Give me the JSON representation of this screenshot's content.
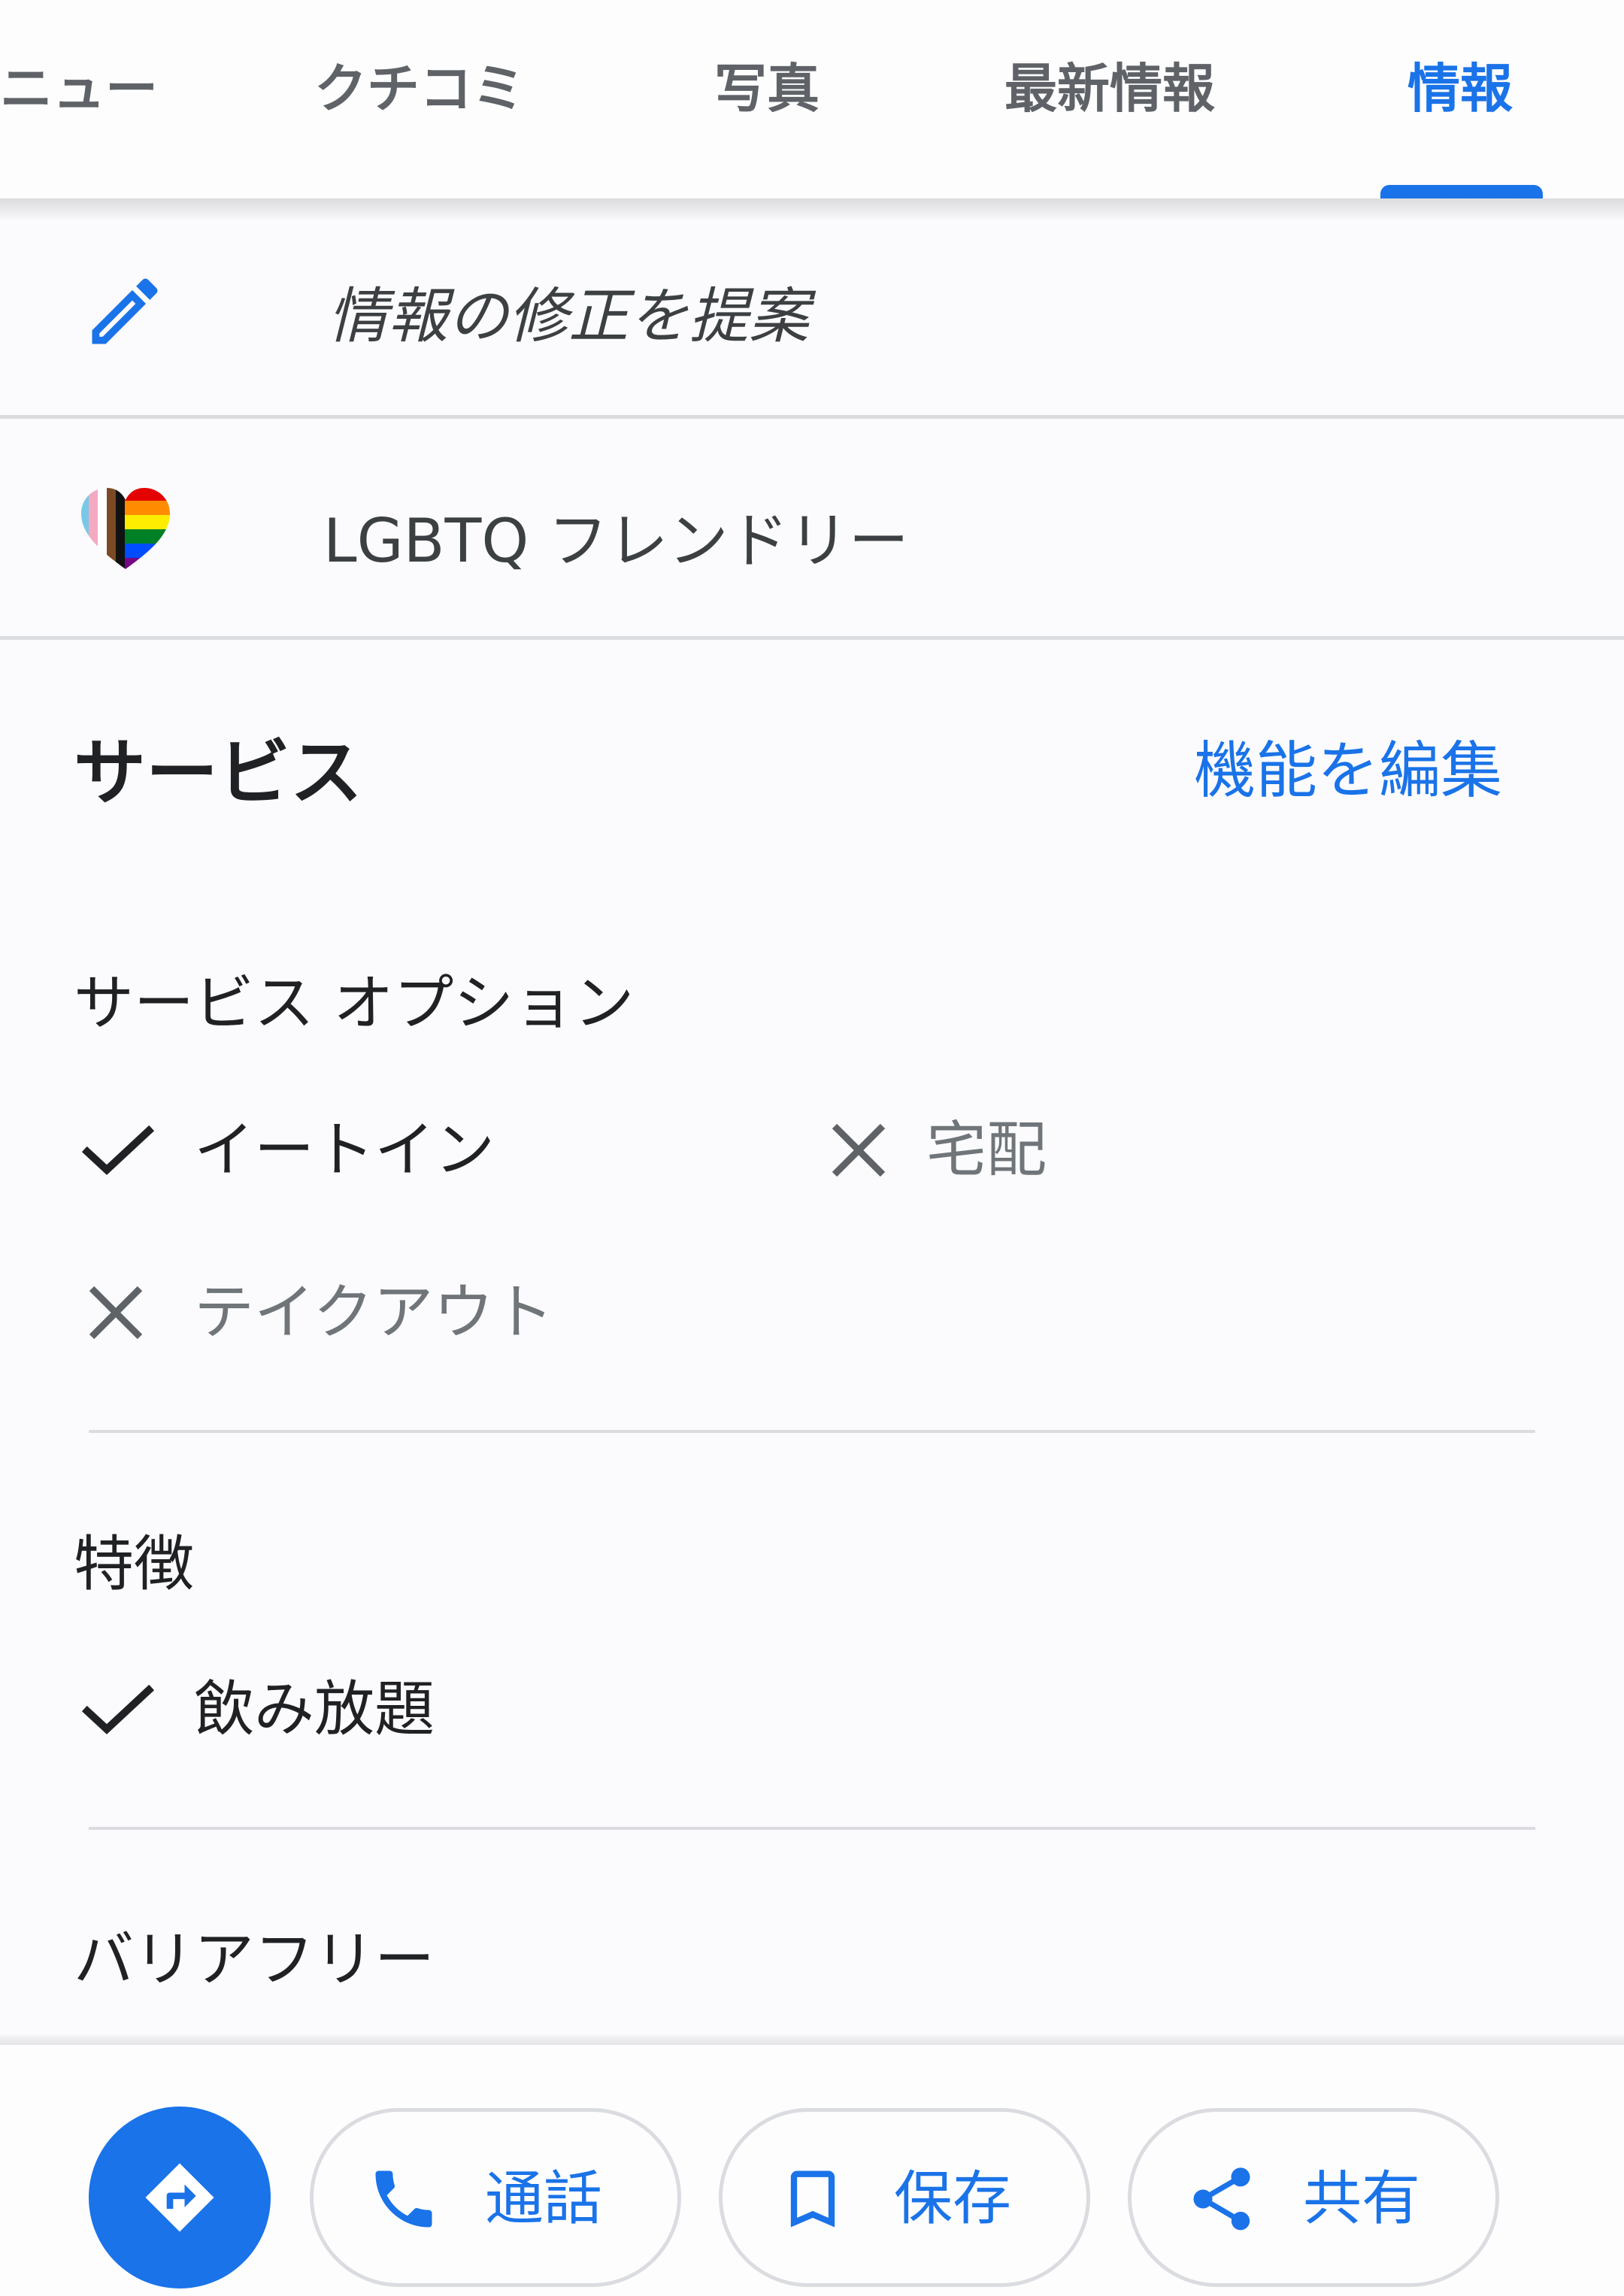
{
  "tabs": [
    {
      "label": "ニュー",
      "active": false
    },
    {
      "label": "クチコミ",
      "active": false
    },
    {
      "label": "写真",
      "active": false
    },
    {
      "label": "最新情報",
      "active": false
    },
    {
      "label": "情報",
      "active": true
    }
  ],
  "suggest_edit": {
    "label": "情報の修正を提案",
    "icon": "pencil-icon"
  },
  "lgbtq": {
    "label": "LGBTQ フレンドリー",
    "icon": "pride-heart-icon"
  },
  "services": {
    "title": "サービス",
    "edit_link": "機能を編集",
    "service_options": {
      "heading": "サービス オプション",
      "items": [
        {
          "label": "イートイン",
          "available": true
        },
        {
          "label": "宅配",
          "available": false
        },
        {
          "label": "テイクアウト",
          "available": false
        }
      ]
    },
    "features": {
      "heading": "特徴",
      "items": [
        {
          "label": "飲み放題",
          "available": true
        }
      ]
    },
    "accessibility": {
      "heading": "バリアフリー"
    }
  },
  "actions": {
    "directions_icon": "directions-icon",
    "call": {
      "label": "通話",
      "icon": "phone-icon"
    },
    "save": {
      "label": "保存",
      "icon": "bookmark-icon"
    },
    "share": {
      "label": "共有",
      "icon": "share-icon"
    }
  },
  "colors": {
    "accent": "#1a73e8",
    "text_primary": "#202124",
    "text_secondary": "#5f6368",
    "divider": "#dadce0"
  }
}
